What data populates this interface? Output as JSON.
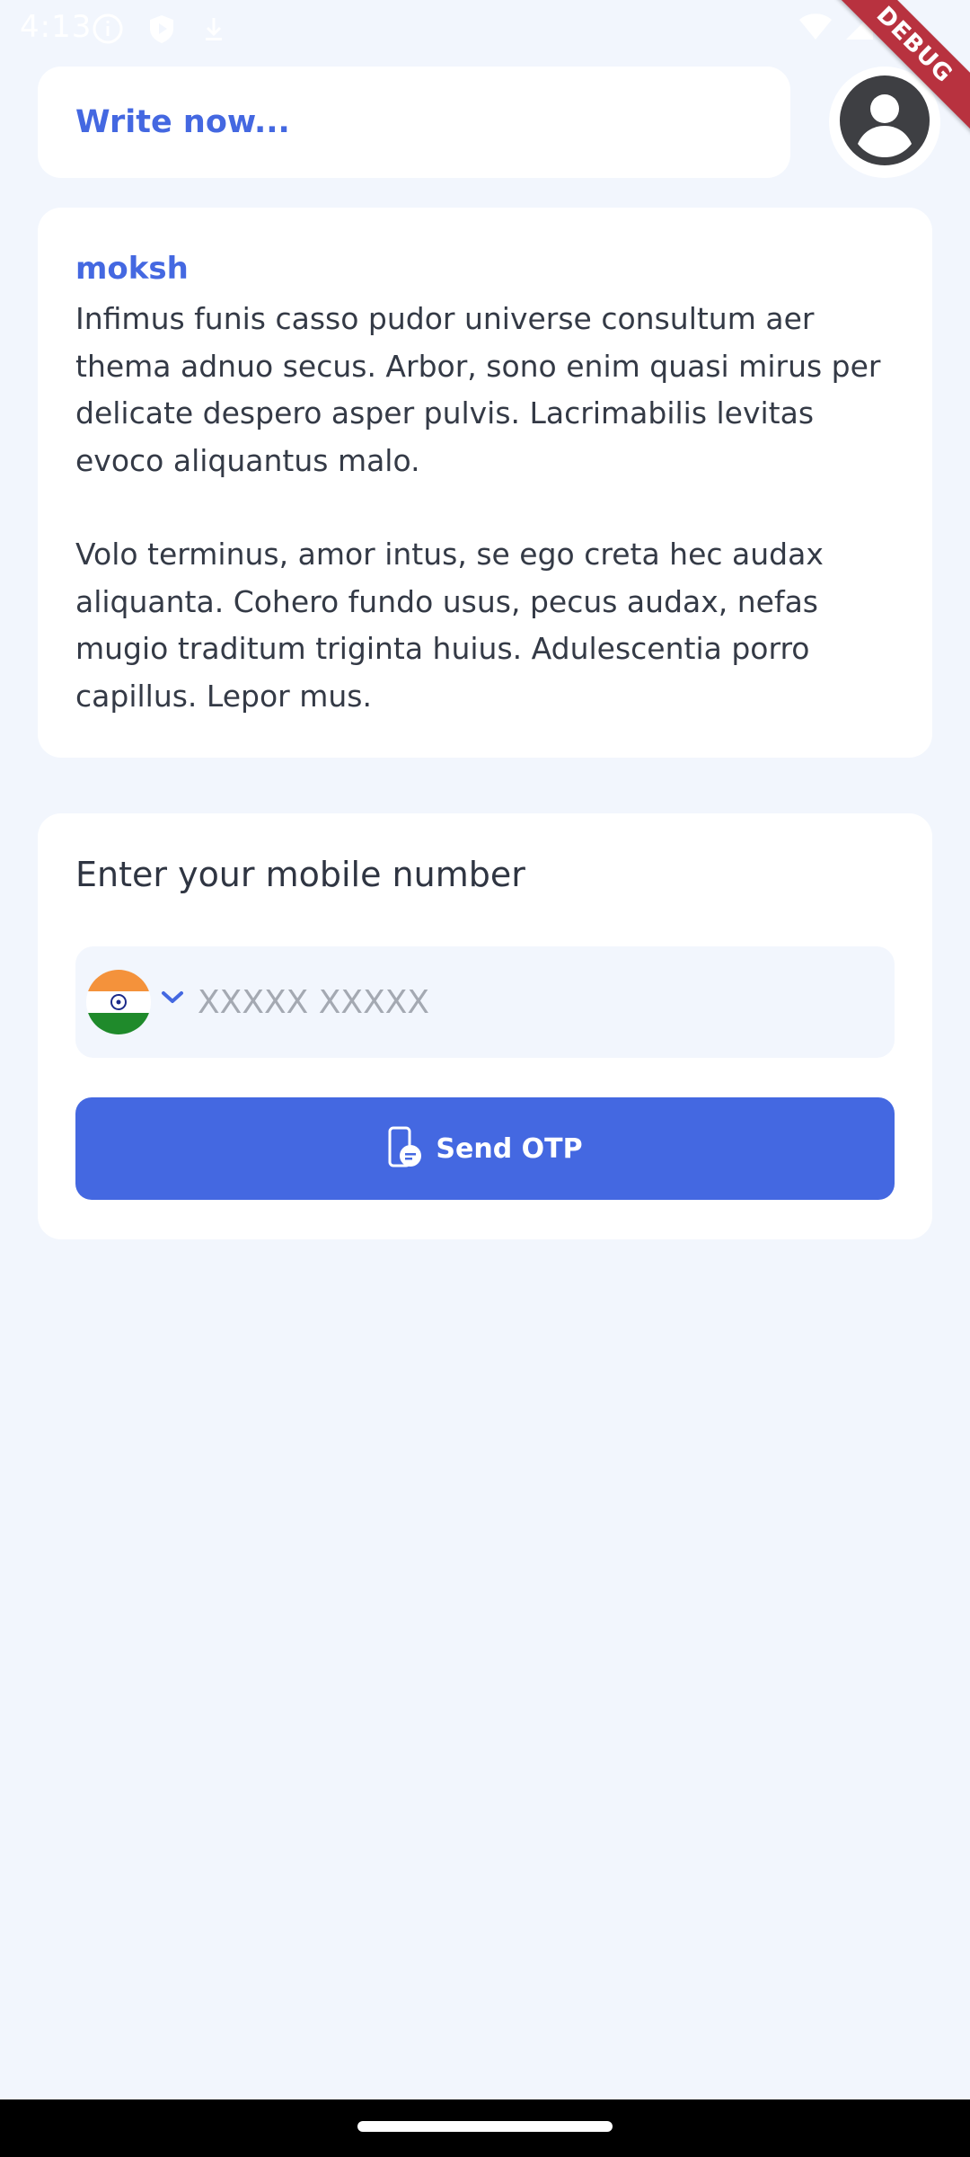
{
  "status_bar": {
    "time": "4:13"
  },
  "debug_banner": {
    "label": "DEBUG"
  },
  "composer": {
    "placeholder": "Write now..."
  },
  "post": {
    "author": "moksh",
    "paragraphs": [
      "Infimus funis casso pudor universe consultum aer thema adnuo secus. Arbor, sono enim quasi mirus per delicate despero asper pulvis. Lacrimabilis levitas evoco aliquantus malo.",
      "Volo terminus, amor intus, se ego creta hec audax aliquanta. Cohero fundo usus, pecus audax, nefas mugio traditum triginta huius. Adulescentia porro capillus. Lepor mus."
    ]
  },
  "login": {
    "title": "Enter your mobile number",
    "phone_placeholder": "XXXXX XXXXX",
    "phone_value": "",
    "send_otp_label": "Send OTP"
  },
  "colors": {
    "accent": "#4468e1",
    "background": "#f2f6fd",
    "card": "#ffffff",
    "text": "#2f3542"
  },
  "icons": {
    "country_flag": "india-flag-icon",
    "avatar": "account-circle-icon",
    "send_otp": "phone-message-icon",
    "chevron": "chevron-down-icon"
  }
}
